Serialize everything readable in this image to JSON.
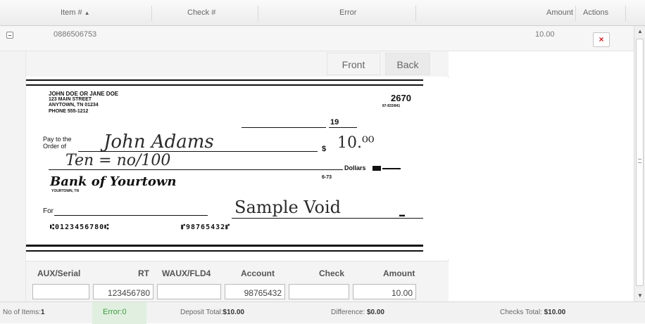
{
  "columns": {
    "item": "Item #",
    "sort_indicator": "▲",
    "check": "Check #",
    "error": "Error",
    "amount": "Amount",
    "actions": "Actions"
  },
  "row": {
    "item_no": "0886506753",
    "amount": "10.00",
    "delete_label": "×"
  },
  "tabs": {
    "front": "Front",
    "back": "Back"
  },
  "check": {
    "owner_line1": "JOHN DOE OR JANE DOE",
    "owner_line2": "123 MAIN STREET",
    "owner_line3": "ANYTOWN, TN 01234",
    "owner_line4": "PHONE 555-1212",
    "check_number": "2670",
    "routing_fraction": "87-833/841",
    "date_suffix": "19",
    "pay_to_label1": "Pay to the",
    "pay_to_label2": "Order of",
    "payee": "John Adams",
    "dollar_sign": "$",
    "amount_written": "10.⁰⁰",
    "written_words": "Ten = no/100",
    "dollars_label": "Dollars",
    "bank_name": "Bank of Yourtown",
    "bank_city": "YOURTOWN, TN",
    "bank_code": "6-73",
    "for_label": "For",
    "memo": "Sample Void",
    "micr_routing": "⑆0123456780⑆",
    "micr_account": "⑈98765432⑈"
  },
  "form": {
    "labels": {
      "aux": "AUX/Serial",
      "rt": "RT",
      "waux": "WAUX/FLD4",
      "account": "Account",
      "check": "Check",
      "amount": "Amount"
    },
    "values": {
      "aux": "",
      "rt": "123456780",
      "waux": "",
      "account": "98765432",
      "check": "",
      "amount": "10.00"
    }
  },
  "footer": {
    "items_label": "No of Items:",
    "items_value": "1",
    "error_label": "Error:",
    "error_value": "0",
    "deposit_label": "Deposit Total:",
    "deposit_value": "$10.00",
    "difference_label": "Difference:",
    "difference_value": "$0.00",
    "checks_label": "Checks Total:",
    "checks_value": "$10.00"
  },
  "colors": {
    "error_green": "#3c9c3c",
    "delete_red": "#d21b1b"
  },
  "icons": {
    "expander": "collapse-icon",
    "delete": "close-icon",
    "scroll_up": "arrow-up-icon",
    "scroll_down": "arrow-down-icon"
  }
}
